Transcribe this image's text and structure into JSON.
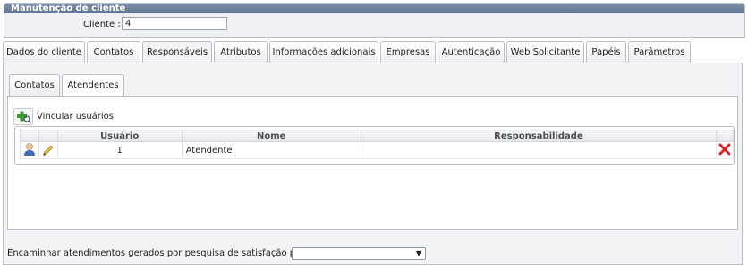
{
  "panel": {
    "title": "Manutenção de cliente",
    "client_label": "Cliente :",
    "client_value": "4"
  },
  "tabs": [
    {
      "label": "Dados do cliente"
    },
    {
      "label": "Contatos"
    },
    {
      "label": "Responsáveis"
    },
    {
      "label": "Atributos"
    },
    {
      "label": "Informações adicionais"
    },
    {
      "label": "Empresas"
    },
    {
      "label": "Autenticação"
    },
    {
      "label": "Web Solicitante"
    },
    {
      "label": "Papéis"
    },
    {
      "label": "Parâmetros"
    }
  ],
  "active_tab": "Responsáveis",
  "subtabs": [
    {
      "label": "Contatos"
    },
    {
      "label": "Atendentes"
    }
  ],
  "active_subtab": "Atendentes",
  "vincular_label": "Vincular usuários",
  "grid": {
    "columns": [
      "Usuário",
      "Nome",
      "Responsabilidade"
    ],
    "rows": [
      {
        "usuario": "1",
        "nome": "Atendente",
        "responsabilidade": ""
      }
    ]
  },
  "footer": {
    "label": "Encaminhar atendimentos gerados por pesquisa de satisfação para :",
    "select_value": "",
    "arrow": "▼"
  },
  "colors": {
    "title_bar": "#6b7c98",
    "border": "#b9bec6",
    "delete_icon": "#d8242b",
    "add_icon": "#3d9a2e"
  }
}
